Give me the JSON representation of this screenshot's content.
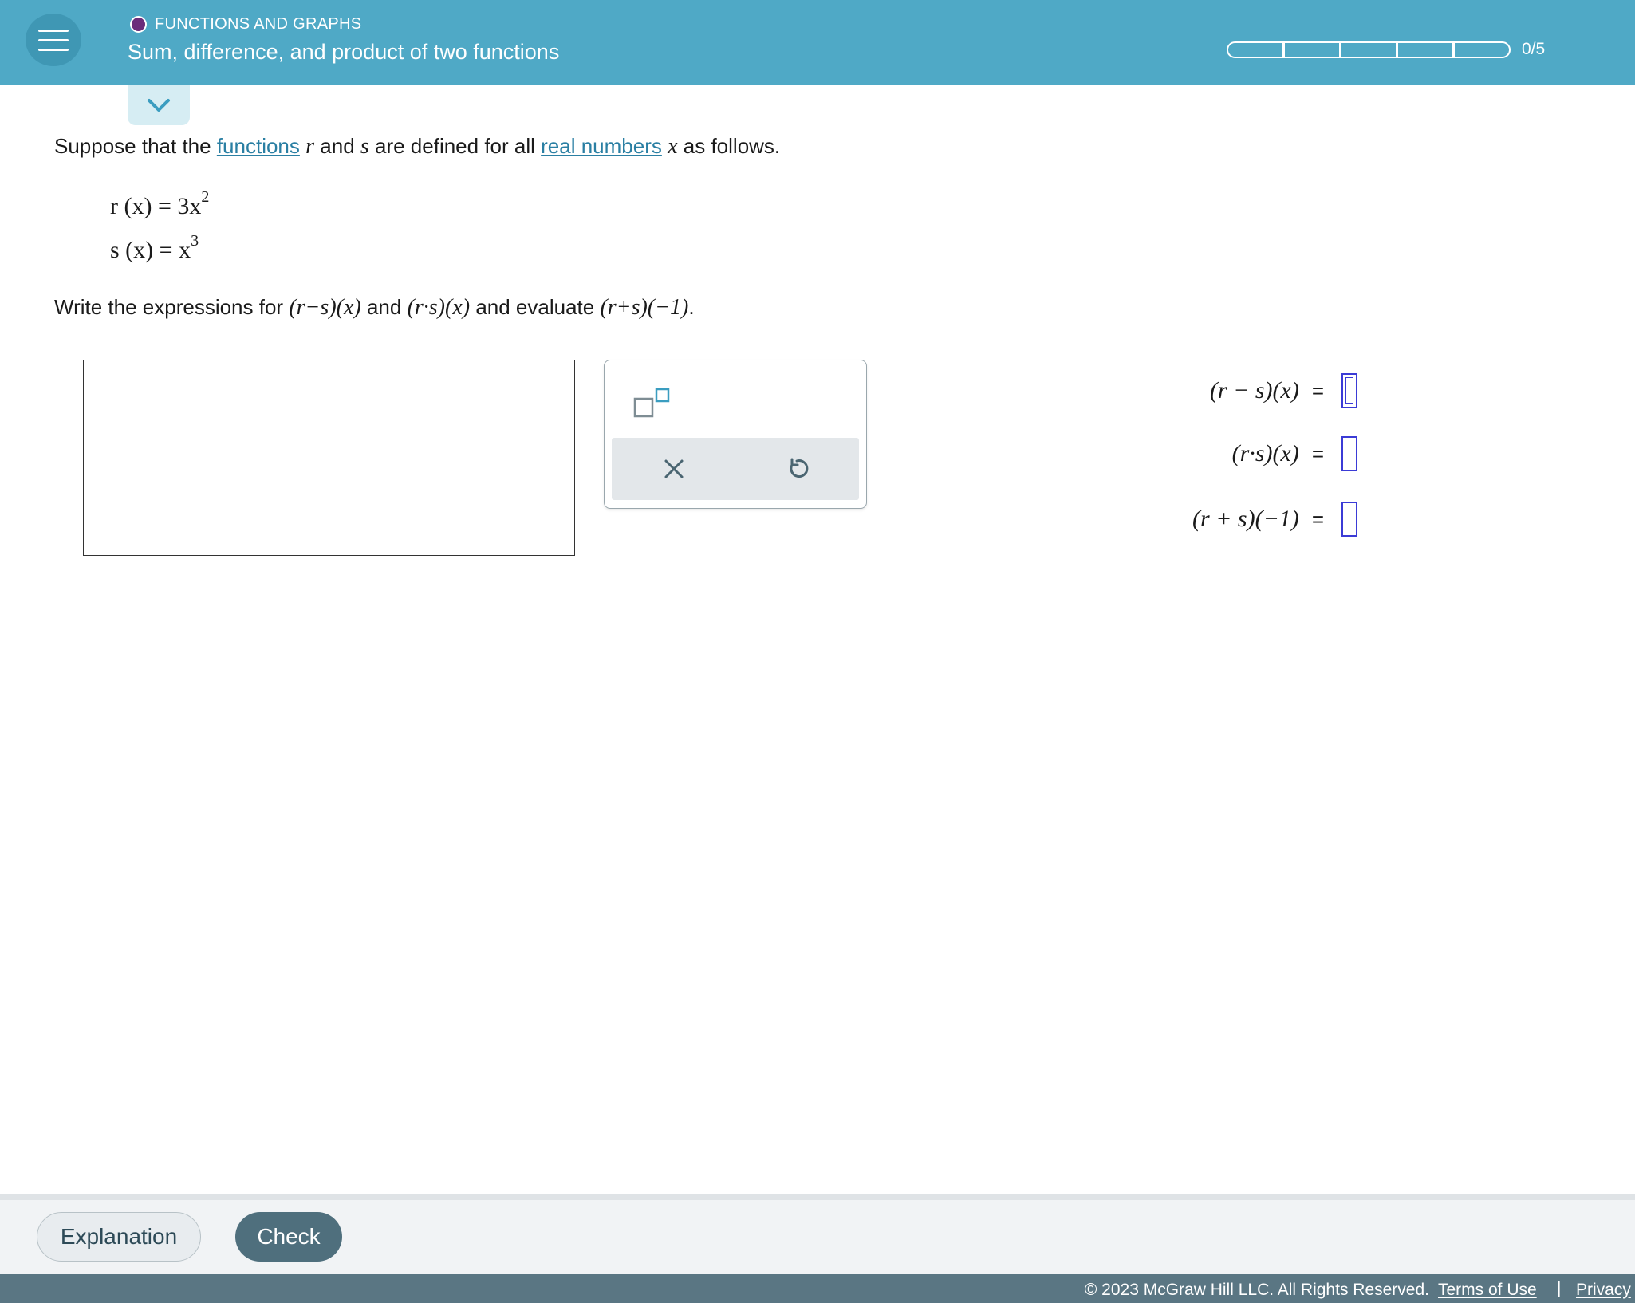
{
  "header": {
    "topic": "FUNCTIONS AND GRAPHS",
    "title": "Sum, difference, and product of two functions",
    "progress_text": "0/5",
    "progress_filled": 0,
    "progress_total": 5,
    "colors": {
      "bar": "#4fa9c6",
      "topic_dot": "#6b2c7a"
    }
  },
  "problem": {
    "intro_1": "Suppose that the ",
    "link_functions": "functions",
    "var_r": "r",
    "intro_2": " and ",
    "var_s": "s",
    "intro_3": " are defined for all ",
    "link_real_numbers": "real numbers",
    "var_x": "x",
    "intro_4": " as follows.",
    "def_r": "r (x) = 3x",
    "def_r_exp": "2",
    "def_s": "s (x) = x",
    "def_s_exp": "3",
    "instr_1": "Write the expressions for ",
    "expr_diff": "(r−s)(x)",
    "instr_2": " and ",
    "expr_prod": "(r·s)(x)",
    "instr_3": " and evaluate ",
    "expr_sum": "(r+s)(−1)",
    "instr_4": "."
  },
  "answers": {
    "row1_label": "(r − s)(x)",
    "row2_label": "(r·s)(x)",
    "row3_label": "(r + s)(−1)",
    "equals": "=",
    "row1_value": "",
    "row2_value": "",
    "row3_value": ""
  },
  "keypad": {
    "exponent_icon": "exponent-template-icon",
    "clear_icon": "x-icon",
    "undo_icon": "undo-icon"
  },
  "footer": {
    "explanation_label": "Explanation",
    "check_label": "Check",
    "copyright": "© 2023 McGraw Hill LLC. All Rights Reserved.",
    "terms_label": "Terms of Use",
    "separator": "|",
    "privacy_label": "Privacy"
  }
}
